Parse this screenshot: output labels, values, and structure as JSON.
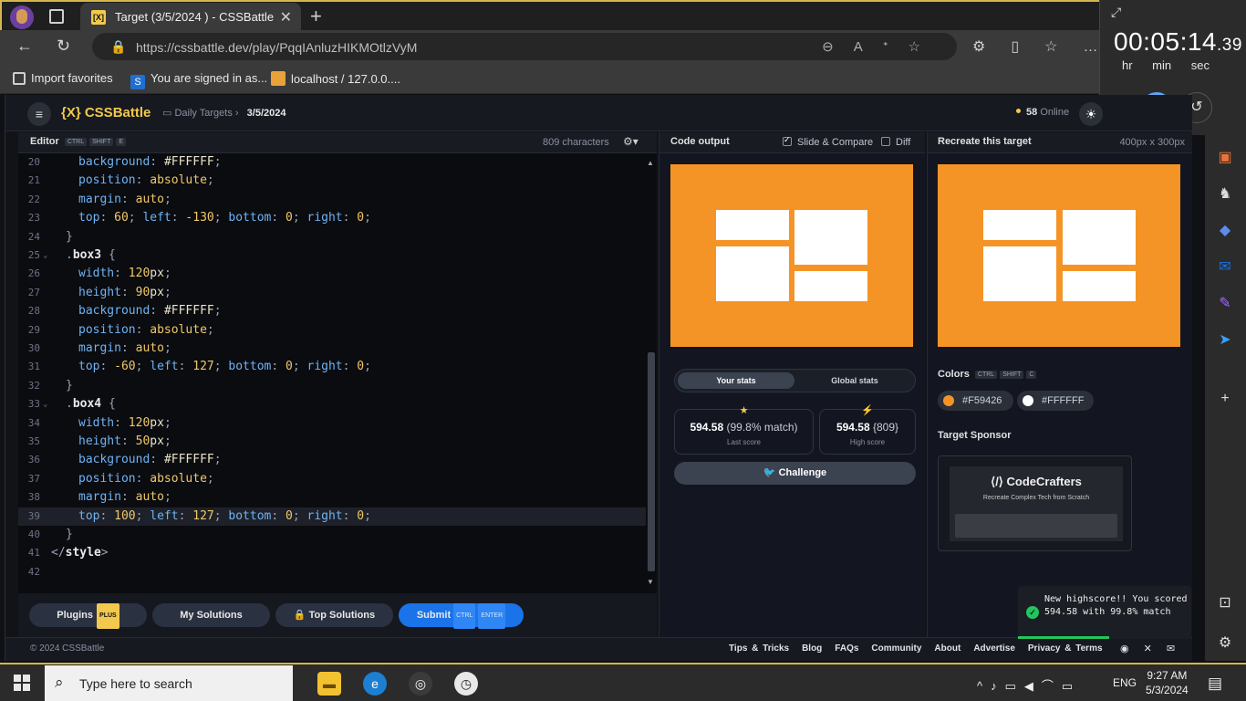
{
  "browser": {
    "tab_title": "Target (3/5/2024 ) - CSSBattle",
    "tab_favicon": "[X]",
    "url": "https://cssbattle.dev/play/PqqIAnluzHIKMOtlzVyM",
    "bookmarks": [
      "Import favorites",
      "You are signed in as...",
      "localhost / 127.0.0...."
    ]
  },
  "timer": {
    "time_main": "00:05:14",
    "time_fraction": ".39",
    "units": "hr min sec"
  },
  "app": {
    "logo": "{X} CSSBattle",
    "breadcrumb_parent": "Daily Targets",
    "breadcrumb_current": "3/5/2024",
    "online_count": "58",
    "online_label": "Online"
  },
  "editor": {
    "title": "Editor",
    "shortcut": [
      "CTRL",
      "SHIFT",
      "E"
    ],
    "char_count": "809 characters",
    "active_line": 39,
    "lines": [
      {
        "n": "20",
        "code": [
          [
            "k",
            "background"
          ],
          [
            "p",
            ": "
          ],
          [
            "n",
            "#FFFFFF"
          ],
          [
            "p",
            ";"
          ]
        ]
      },
      {
        "n": "21",
        "code": [
          [
            "k",
            "position"
          ],
          [
            "p",
            ": "
          ],
          [
            "v",
            "absolute"
          ],
          [
            "p",
            ";"
          ]
        ]
      },
      {
        "n": "22",
        "code": [
          [
            "k",
            "margin"
          ],
          [
            "p",
            ": "
          ],
          [
            "v",
            "auto"
          ],
          [
            "p",
            ";"
          ]
        ]
      },
      {
        "n": "23",
        "code": [
          [
            "k",
            "top"
          ],
          [
            "p",
            ": "
          ],
          [
            "v",
            "60"
          ],
          [
            "p",
            "; "
          ],
          [
            "k",
            "left"
          ],
          [
            "p",
            ": "
          ],
          [
            "v",
            "-130"
          ],
          [
            "p",
            "; "
          ],
          [
            "k",
            "bottom"
          ],
          [
            "p",
            ": "
          ],
          [
            "v",
            "0"
          ],
          [
            "p",
            "; "
          ],
          [
            "k",
            "right"
          ],
          [
            "p",
            ": "
          ],
          [
            "v",
            "0"
          ],
          [
            "p",
            ";"
          ]
        ]
      },
      {
        "n": "24",
        "code": [
          [
            "p",
            "}"
          ]
        ],
        "indent": "brace"
      },
      {
        "n": "25",
        "code": [
          [
            "p",
            "."
          ],
          [
            "s",
            "box3"
          ],
          [
            "p",
            " {"
          ]
        ],
        "indent": "selector",
        "fold": true
      },
      {
        "n": "26",
        "code": [
          [
            "k",
            "width"
          ],
          [
            "p",
            ": "
          ],
          [
            "v",
            "120"
          ],
          [
            "n",
            "px"
          ],
          [
            "p",
            ";"
          ]
        ]
      },
      {
        "n": "27",
        "code": [
          [
            "k",
            "height"
          ],
          [
            "p",
            ": "
          ],
          [
            "v",
            "90"
          ],
          [
            "n",
            "px"
          ],
          [
            "p",
            ";"
          ]
        ]
      },
      {
        "n": "28",
        "code": [
          [
            "k",
            "background"
          ],
          [
            "p",
            ": "
          ],
          [
            "n",
            "#FFFFFF"
          ],
          [
            "p",
            ";"
          ]
        ]
      },
      {
        "n": "29",
        "code": [
          [
            "k",
            "position"
          ],
          [
            "p",
            ": "
          ],
          [
            "v",
            "absolute"
          ],
          [
            "p",
            ";"
          ]
        ]
      },
      {
        "n": "30",
        "code": [
          [
            "k",
            "margin"
          ],
          [
            "p",
            ": "
          ],
          [
            "v",
            "auto"
          ],
          [
            "p",
            ";"
          ]
        ]
      },
      {
        "n": "31",
        "code": [
          [
            "k",
            "top"
          ],
          [
            "p",
            ": "
          ],
          [
            "v",
            "-60"
          ],
          [
            "p",
            "; "
          ],
          [
            "k",
            "left"
          ],
          [
            "p",
            ": "
          ],
          [
            "v",
            "127"
          ],
          [
            "p",
            "; "
          ],
          [
            "k",
            "bottom"
          ],
          [
            "p",
            ": "
          ],
          [
            "v",
            "0"
          ],
          [
            "p",
            "; "
          ],
          [
            "k",
            "right"
          ],
          [
            "p",
            ": "
          ],
          [
            "v",
            "0"
          ],
          [
            "p",
            ";"
          ]
        ]
      },
      {
        "n": "32",
        "code": [
          [
            "p",
            "}"
          ]
        ],
        "indent": "brace"
      },
      {
        "n": "33",
        "code": [
          [
            "p",
            "."
          ],
          [
            "s",
            "box4"
          ],
          [
            "p",
            " {"
          ]
        ],
        "indent": "selector",
        "fold": true
      },
      {
        "n": "34",
        "code": [
          [
            "k",
            "width"
          ],
          [
            "p",
            ": "
          ],
          [
            "v",
            "120"
          ],
          [
            "n",
            "px"
          ],
          [
            "p",
            ";"
          ]
        ]
      },
      {
        "n": "35",
        "code": [
          [
            "k",
            "height"
          ],
          [
            "p",
            ": "
          ],
          [
            "v",
            "50"
          ],
          [
            "n",
            "px"
          ],
          [
            "p",
            ";"
          ]
        ]
      },
      {
        "n": "36",
        "code": [
          [
            "k",
            "background"
          ],
          [
            "p",
            ": "
          ],
          [
            "n",
            "#FFFFFF"
          ],
          [
            "p",
            ";"
          ]
        ]
      },
      {
        "n": "37",
        "code": [
          [
            "k",
            "position"
          ],
          [
            "p",
            ": "
          ],
          [
            "v",
            "absolute"
          ],
          [
            "p",
            ";"
          ]
        ]
      },
      {
        "n": "38",
        "code": [
          [
            "k",
            "margin"
          ],
          [
            "p",
            ": "
          ],
          [
            "v",
            "auto"
          ],
          [
            "p",
            ";"
          ]
        ]
      },
      {
        "n": "39",
        "code": [
          [
            "k",
            "top"
          ],
          [
            "p",
            ": "
          ],
          [
            "v",
            "100"
          ],
          [
            "p",
            "; "
          ],
          [
            "k",
            "left"
          ],
          [
            "p",
            ": "
          ],
          [
            "v",
            "127"
          ],
          [
            "p",
            "; "
          ],
          [
            "k",
            "bottom"
          ],
          [
            "p",
            ": "
          ],
          [
            "v",
            "0"
          ],
          [
            "p",
            "; "
          ],
          [
            "k",
            "right"
          ],
          [
            "p",
            ": "
          ],
          [
            "v",
            "0"
          ],
          [
            "p",
            ";"
          ]
        ]
      },
      {
        "n": "40",
        "code": [
          [
            "p",
            "}"
          ]
        ],
        "indent": "brace"
      },
      {
        "n": "41",
        "code": [
          [
            "p",
            "</"
          ],
          [
            "s",
            "style"
          ],
          [
            "p",
            ">"
          ]
        ],
        "indent": "root"
      },
      {
        "n": "42",
        "code": [],
        "indent": "root"
      }
    ],
    "buttons": {
      "plugins": "Plugins",
      "plugins_tag": "PLUS",
      "my_solutions": "My Solutions",
      "top_solutions": "Top Solutions",
      "submit": "Submit",
      "submit_keys": [
        "CTRL",
        "ENTER"
      ]
    }
  },
  "output": {
    "title": "Code output",
    "slide_compare": "Slide & Compare",
    "diff": "Diff",
    "stats_tab_active": "Your stats",
    "stats_tab_other": "Global stats",
    "last_score_value": "594.58",
    "last_score_match": "(99.8% match)",
    "last_score_label": "Last score",
    "high_score_value": "594.58",
    "high_score_chars": "{809}",
    "high_score_label": "High score",
    "challenge": "Challenge"
  },
  "target": {
    "title": "Recreate this target",
    "size": "400px x 300px",
    "colors_title": "Colors",
    "colors_shortcut": [
      "CTRL",
      "SHIFT",
      "C"
    ],
    "colors": [
      {
        "hex": "#F59426",
        "label": "#F59426"
      },
      {
        "hex": "#FFFFFF",
        "label": "#FFFFFF"
      }
    ],
    "sponsor_title": "Target Sponsor",
    "sponsor_name": "CodeCrafters",
    "sponsor_tagline": "Recreate Complex Tech from Scratch"
  },
  "toast": {
    "message": "New highscore!! You scored 594.58 with 99.8% match"
  },
  "footer": {
    "copyright": "© 2024 CSSBattle",
    "links": [
      "Tips & Tricks",
      "Blog",
      "FAQs",
      "Community",
      "About",
      "Advertise",
      "Privacy & Terms"
    ]
  },
  "taskbar": {
    "search_placeholder": "Type here to search",
    "lang": "ENG",
    "time": "9:27 AM",
    "date": "5/3/2024"
  },
  "colors": {
    "accent": "#F2C94C",
    "canvas": "#F59426",
    "box": "#FFFFFF",
    "submit": "#1A73E8"
  }
}
